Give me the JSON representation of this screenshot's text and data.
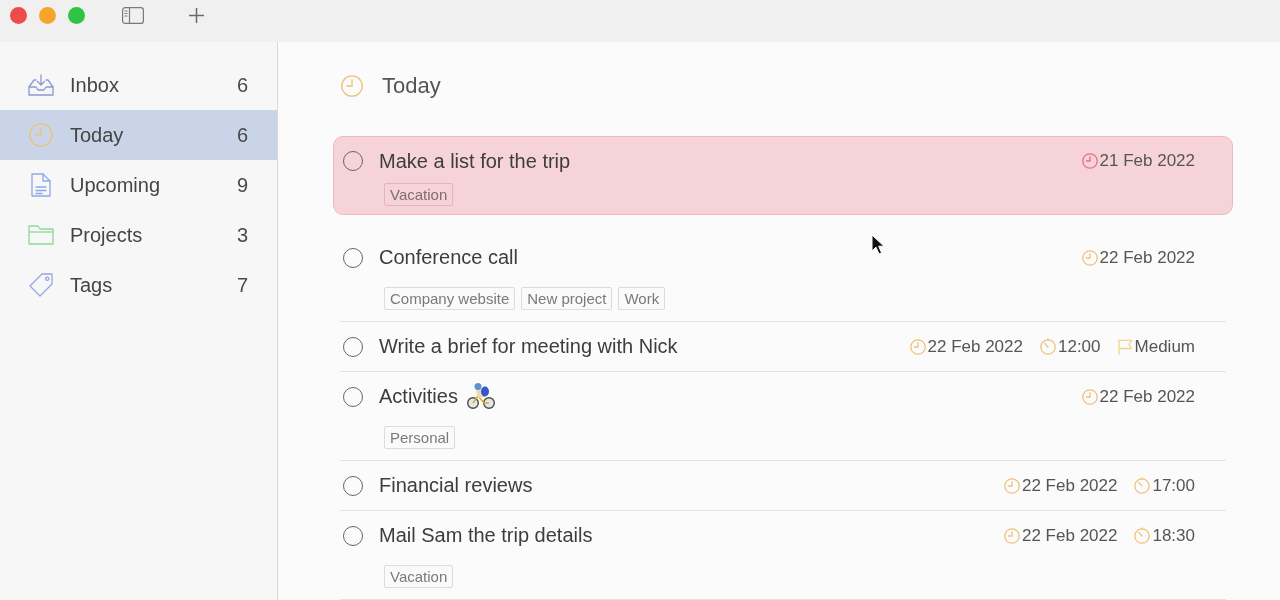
{
  "sidebar": {
    "items": [
      {
        "label": "Inbox",
        "count": "6",
        "selected": false
      },
      {
        "label": "Today",
        "count": "6",
        "selected": true
      },
      {
        "label": "Upcoming",
        "count": "9",
        "selected": false
      },
      {
        "label": "Projects",
        "count": "3",
        "selected": false
      },
      {
        "label": "Tags",
        "count": "7",
        "selected": false
      }
    ]
  },
  "main": {
    "title": "Today"
  },
  "tasks": [
    {
      "title": "Make a list for the trip",
      "has_emoji": false,
      "checked": false,
      "selected": true,
      "overdue": true,
      "tags": [
        "Vacation"
      ],
      "meta": [
        {
          "kind": "date",
          "text": "21 Feb 2022"
        }
      ]
    },
    {
      "title": "Conference call",
      "has_emoji": false,
      "checked": false,
      "selected": false,
      "overdue": false,
      "tags": [
        "Company website",
        "New project",
        "Work"
      ],
      "meta": [
        {
          "kind": "date",
          "text": "22 Feb 2022"
        }
      ]
    },
    {
      "title": "Write a brief for meeting with Nick",
      "has_emoji": false,
      "checked": false,
      "selected": false,
      "overdue": false,
      "meta": [
        {
          "kind": "date",
          "text": "22 Feb 2022"
        },
        {
          "kind": "time",
          "text": "12:00"
        },
        {
          "kind": "priority",
          "text": "Medium"
        }
      ]
    },
    {
      "title": "Activities",
      "has_emoji": true,
      "checked": false,
      "selected": false,
      "overdue": false,
      "tags": [
        "Personal"
      ],
      "meta": [
        {
          "kind": "date",
          "text": "22 Feb 2022"
        }
      ]
    },
    {
      "title": "Financial reviews",
      "has_emoji": false,
      "checked": false,
      "selected": false,
      "overdue": false,
      "meta": [
        {
          "kind": "date",
          "text": "22 Feb 2022"
        },
        {
          "kind": "time",
          "text": "17:00"
        }
      ]
    },
    {
      "title": "Mail Sam the trip details",
      "has_emoji": false,
      "checked": false,
      "selected": false,
      "overdue": false,
      "tags": [
        "Vacation"
      ],
      "meta": [
        {
          "kind": "date",
          "text": "22 Feb 2022"
        },
        {
          "kind": "time",
          "text": "18:30"
        }
      ]
    }
  ]
}
